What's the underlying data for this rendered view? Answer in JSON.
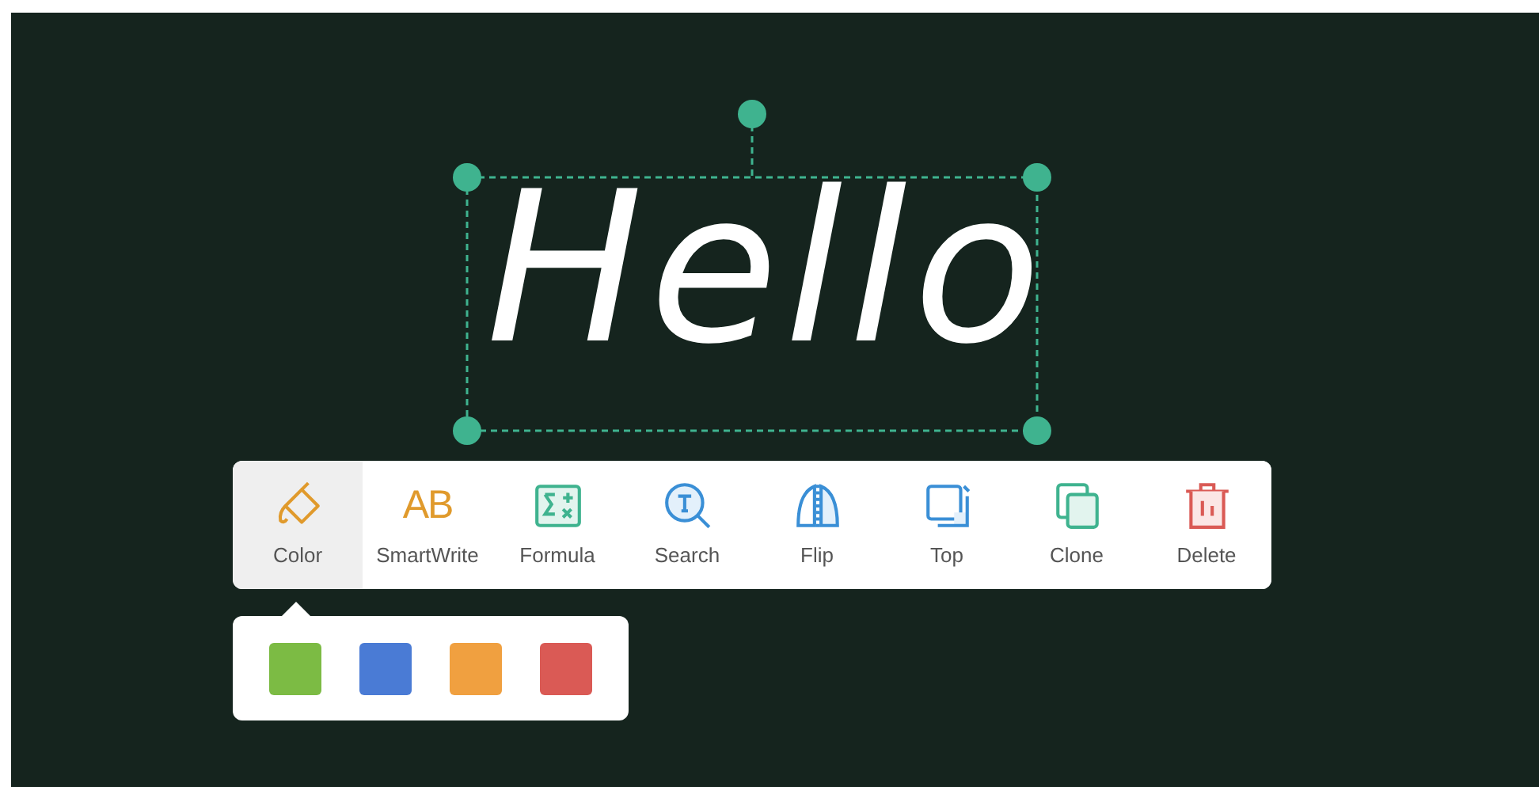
{
  "canvas": {
    "ink_text": "Hello",
    "selected": true
  },
  "toolbar": {
    "tools": [
      {
        "kind": "color",
        "label": "Color",
        "selected": true
      },
      {
        "kind": "smartwrite",
        "label": "SmartWrite",
        "icon_text": "AB",
        "selected": false
      },
      {
        "kind": "formula",
        "label": "Formula",
        "selected": false
      },
      {
        "kind": "search",
        "label": "Search",
        "selected": false
      },
      {
        "kind": "flip",
        "label": "Flip",
        "selected": false
      },
      {
        "kind": "top",
        "label": "Top",
        "selected": false
      },
      {
        "kind": "clone",
        "label": "Clone",
        "selected": false
      },
      {
        "kind": "delete",
        "label": "Delete",
        "selected": false
      }
    ]
  },
  "color_popup": {
    "swatches": [
      {
        "color": "#7cbb44"
      },
      {
        "color": "#4a7bd5"
      },
      {
        "color": "#f0a040"
      },
      {
        "color": "#da5a55"
      }
    ]
  }
}
